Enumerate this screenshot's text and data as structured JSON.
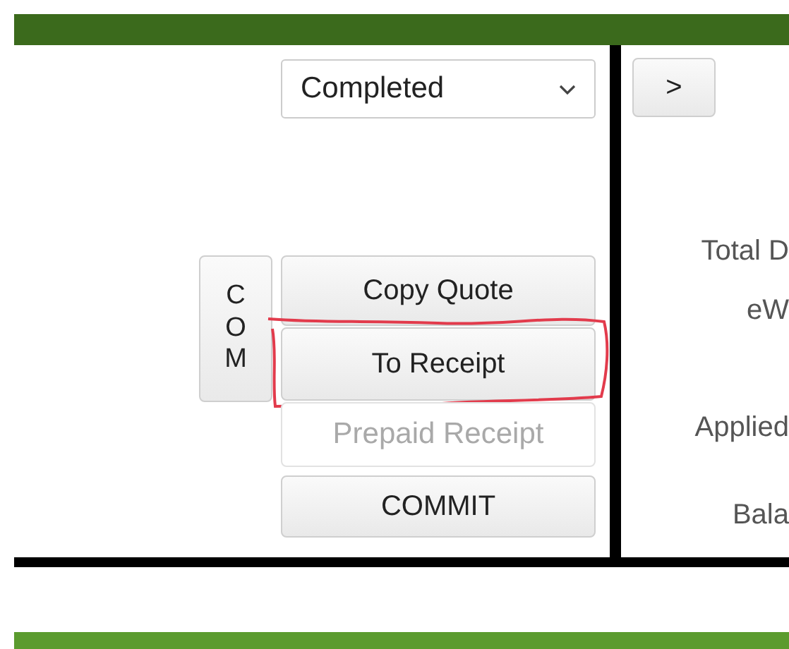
{
  "status_select": {
    "value": "Completed"
  },
  "side_button": {
    "label": "COM"
  },
  "buttons": [
    {
      "label": "Copy Quote",
      "disabled": false,
      "circled": false
    },
    {
      "label": "To Receipt",
      "disabled": false,
      "circled": true
    },
    {
      "label": "Prepaid Receipt",
      "disabled": true,
      "circled": false
    },
    {
      "label": "COMMIT",
      "disabled": false,
      "circled": false
    }
  ],
  "next_button": {
    "label": ">"
  },
  "summary_labels": [
    "Total D",
    "eW",
    "Applied",
    "Bala"
  ]
}
